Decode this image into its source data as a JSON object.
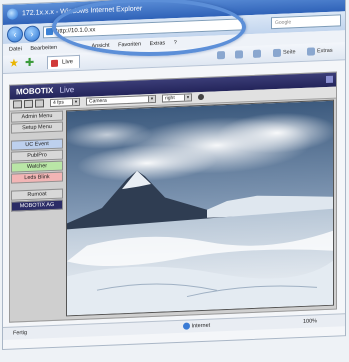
{
  "browser": {
    "window_title": "172.1x.x.x - Windows Internet Explorer",
    "address": "http://10.1.0.xx",
    "search_placeholder": "Google",
    "menu": [
      "Datei",
      "Bearbeiten",
      "Ansicht",
      "Favoriten",
      "Extras",
      "?"
    ],
    "tab_label": "Live",
    "commands": [
      "Seite",
      "Extras"
    ],
    "status_left": "Fertig",
    "status_zone": "Internet",
    "zoom": "100%"
  },
  "camera": {
    "brand": "MOBOTIX",
    "view": "Live",
    "fps_select": "4 fps",
    "camera_select": "Camera",
    "light_select": "right",
    "side_menu": [
      "Admin Menu",
      "Setup Menu",
      "UC Event",
      "PublPro",
      "Watcher",
      "Leds Blink",
      "Rumoat",
      "MOBOTIX AG"
    ]
  },
  "colors": {
    "accent": "#5c8fd8",
    "header": "#2b2c66",
    "green": "#b9e6a6",
    "pink": "#f2b5b5",
    "blue_btn": "#bdd0ee"
  }
}
